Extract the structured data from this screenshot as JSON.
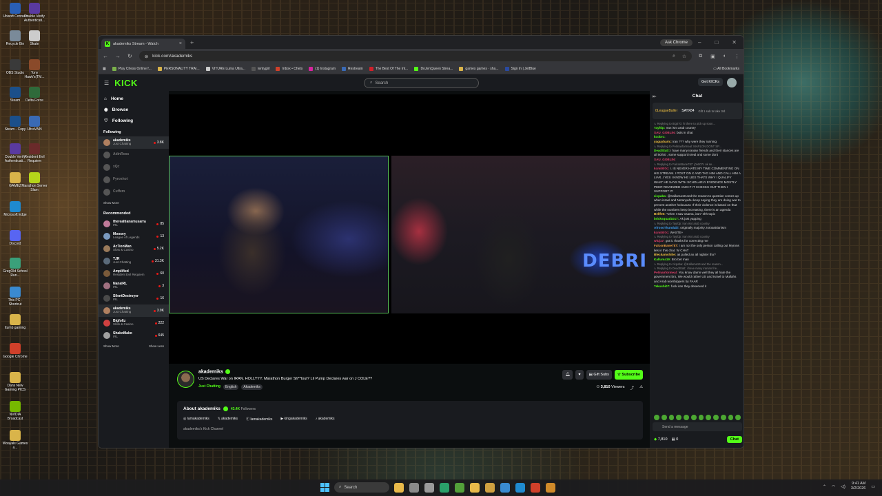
{
  "desktop": {
    "icons": [
      {
        "label": "Ubisoft Connect",
        "color": "#2a5fb5"
      },
      {
        "label": "Double Verify Authenticati...",
        "color": "#5a3aa0"
      },
      {
        "label": "Recycle Bin",
        "color": "#7a8a99"
      },
      {
        "label": "Skate",
        "color": "#cccccc"
      },
      {
        "label": "OBS Studio",
        "color": "#3a3a3a"
      },
      {
        "label": "Tony Hawk's(TM...",
        "color": "#8a4a2a"
      },
      {
        "label": "Steam",
        "color": "#1b4f8a"
      },
      {
        "label": "Delta Force",
        "color": "#2f6a3a"
      },
      {
        "label": "Steam - Copy",
        "color": "#1b4f8a"
      },
      {
        "label": "UltraVNN",
        "color": "#3a6ab5"
      },
      {
        "label": "Double Verify Authenticati...",
        "color": "#5a3aa0"
      },
      {
        "label": "Resident Evil Requiem",
        "color": "#6a2a2a"
      },
      {
        "label": "GAMEZ",
        "color": "#d9b44a"
      },
      {
        "label": "Marathon Server Slam",
        "color": "#b5d41a"
      },
      {
        "label": "Microsoft Edge",
        "color": "#1f8ad0"
      },
      {
        "label": "Discord",
        "color": "#5865f2"
      },
      {
        "label": "GregOld School Run...",
        "color": "#3aa07a"
      },
      {
        "label": "This PC - Shortcut",
        "color": "#3a8ad0"
      },
      {
        "label": "ttumb gaming",
        "color": "#d9b44a"
      },
      {
        "label": "Google Chrome",
        "color": "#d0402a"
      },
      {
        "label": "Dans New Gaming PICS",
        "color": "#d9b44a"
      },
      {
        "label": "NVIDIA Broadcast",
        "color": "#76b900"
      },
      {
        "label": "Woayals Games a...",
        "color": "#d9b44a"
      }
    ]
  },
  "browser": {
    "tab_title": "akademiks Stream - Watch",
    "ask_chrome": "Ask Chrome",
    "url": "kick.com/akademiks",
    "bookmarks": [
      {
        "label": "Play Chess Online f...",
        "color": "#7ab04a"
      },
      {
        "label": "PERSONALITY TRAI...",
        "color": "#d9b44a"
      },
      {
        "label": "VITURE Luma Ultra...",
        "color": "#cccccc"
      },
      {
        "label": "tentygirl",
        "color": "#555555"
      },
      {
        "label": "Inbox • Chets",
        "color": "#d0402a"
      },
      {
        "label": "(1) Instagram",
        "color": "#d6249f"
      },
      {
        "label": "Restream",
        "color": "#3a6ab5"
      },
      {
        "label": "The Best Of The Int...",
        "color": "#d0202a"
      },
      {
        "label": "DoJenQueen Strea...",
        "color": "#53fc18"
      },
      {
        "label": "games games · sha...",
        "color": "#d9b44a"
      },
      {
        "label": "Sign In | JetBlue",
        "color": "#2a4aa0"
      }
    ],
    "all_bookmarks": "All Bookmarks"
  },
  "kick": {
    "logo": "KICK",
    "search_placeholder": "Search",
    "get_kicks": "Get KICKs",
    "nav": [
      {
        "label": "Home",
        "icon": "home-icon",
        "glyph": "⌂"
      },
      {
        "label": "Browse",
        "icon": "browse-icon",
        "glyph": "◉"
      },
      {
        "label": "Following",
        "icon": "heart-icon",
        "glyph": "♡"
      }
    ],
    "following_header": "Following",
    "following": [
      {
        "name": "akademiks",
        "category": "Just Chatting",
        "viewers": "3.8K",
        "online": true,
        "color": "#b08060"
      },
      {
        "name": "AdinRoss",
        "category": "",
        "viewers": "",
        "online": false,
        "color": "#555555"
      },
      {
        "name": "xQc",
        "category": "",
        "viewers": "",
        "online": false,
        "color": "#555555"
      },
      {
        "name": "Fyroshot",
        "category": "",
        "viewers": "",
        "online": false,
        "color": "#555555"
      },
      {
        "name": "Cuffem",
        "category": "",
        "viewers": "",
        "online": false,
        "color": "#555555"
      }
    ],
    "show_more_1": "Show More",
    "recommended_header": "Recommended",
    "recommended": [
      {
        "name": "therealtianamusarra",
        "category": "IRL",
        "viewers": "85",
        "color": "#c07a9a"
      },
      {
        "name": "Moosey",
        "category": "League of Legends",
        "viewers": "13",
        "color": "#7a9ac0"
      },
      {
        "name": "Ac7ionMan",
        "category": "Slots & Casino",
        "viewers": "5.2K",
        "color": "#9a7a5a"
      },
      {
        "name": "TJR",
        "category": "Just Chatting",
        "viewers": "31.3K",
        "color": "#5a6a7a"
      },
      {
        "name": "Amplified",
        "category": "Resident Evil Requiem",
        "viewers": "60",
        "color": "#7a5a3a"
      },
      {
        "name": "NanaIRL",
        "category": "IRL",
        "viewers": "3",
        "color": "#a07080"
      },
      {
        "name": "SilentDestroyer",
        "category": "IRL",
        "viewers": "16",
        "color": "#4a4a4a"
      },
      {
        "name": "akademiks",
        "category": "Just Chatting",
        "viewers": "3.9K",
        "color": "#b08060"
      },
      {
        "name": "Bigfoltz",
        "category": "Slots & Casino",
        "viewers": "222",
        "color": "#d04040"
      },
      {
        "name": "ShakoMako",
        "category": "IRL",
        "viewers": "645",
        "color": "#a0a0a0"
      }
    ],
    "show_more_2": "Show More",
    "show_less": "Show Less",
    "video_overlay_text": "DEBRI",
    "stream": {
      "channel": "akademiks",
      "title": "US Declares War on IRAN. HOLLYYY. Marathon Burger Sh**tout? Lil Pump Declares war on J COLE??",
      "category": "Just Chatting",
      "tags": [
        "English",
        "Akademiks"
      ],
      "gift_subs": "Gift Subs",
      "subscribe": "Subscribe",
      "viewers": "3,810",
      "viewers_label": "Viewers"
    },
    "about": {
      "title": "About akademiks",
      "followers": "43.4K",
      "followers_label": "Followers",
      "socials": [
        {
          "label": "lamakademiks",
          "icon": "instagram-icon",
          "glyph": "◎"
        },
        {
          "label": "akademiks",
          "icon": "x-icon",
          "glyph": "𝕏"
        },
        {
          "label": "lamakademiks",
          "icon": "facebook-icon",
          "glyph": "ⓕ"
        },
        {
          "label": "kingakademiks",
          "icon": "youtube-icon",
          "glyph": "▶"
        },
        {
          "label": "akademiks",
          "icon": "tiktok-icon",
          "glyph": "♪"
        }
      ],
      "description": "akademiks's Kick Channel"
    },
    "chat": {
      "title": "Chat",
      "pinned_user1": "0LeagueBaller",
      "pinned_user2": "SATX84",
      "pinned_text": "Gift 1 sub to take 3rd",
      "messages": [
        {
          "user": "",
          "color": "#888888",
          "text": "Replying to Big070: hi there to pick up soon...",
          "reply": true
        },
        {
          "user": "Tayfdp:",
          "color": "#53fc18",
          "text": "Iran isnt arab country"
        },
        {
          "user": "SAU_GOBLIN:",
          "color": "#e0406a",
          "text": "bots in chat"
        },
        {
          "user": "kcobrc:",
          "color": "#53fc18",
          "text": ""
        },
        {
          "user": "yaguybaric:",
          "color": "#f0c040",
          "text": "iran ??? why were they running"
        },
        {
          "user": "",
          "color": "#888888",
          "text": "Replying to Pelmanformeal: MARLON DONT SP...",
          "reply": true
        },
        {
          "user": "DeadStatt:",
          "color": "#53fc18",
          "text": "i have many iranian friends and their stances are all 50/50 , some support isreal and some dont"
        },
        {
          "user": "SAU_GOBLIN:",
          "color": "#e0406a",
          "text": ""
        },
        {
          "user": "",
          "color": "#888888",
          "text": "Replying to FalconBane787: j0e007c ok se...",
          "reply": true
        },
        {
          "user": "kcmi007c:",
          "color": "#e0406a",
          "text": "I. IS NEVER HATE MY TIME COMMENTING ON HIS STREAM. I POST ON X AND TAG HIM AND CALL HIM A LIAR..I YES I KNOW HE LIES THATS WHY I QUALIFY WHAT HE SAYS WITH SCHOLARLY EVIDENCE MOSTLY PEER REVIEWED AND IF IT CHECKS OUT THEN I SUPPORT IT."
        },
        {
          "user": "zicpaba:",
          "color": "#53fc18",
          "text": "@Kalluma19 and the reason to question comes up when israel and Netanyahu keep saying they are doing war to prevent another holocaust. If their violence is based on that while the numbers keep increasing, there is an agenda"
        },
        {
          "user": "Bellfe5:",
          "color": "#f0c040",
          "text": "\"when I saw osama, iran\" shh topic"
        },
        {
          "user": "bricksquad1017:",
          "color": "#53fc18",
          "text": "Ak just yapping"
        },
        {
          "user": "",
          "color": "#888888",
          "text": "Replying to Tayfdp: Iran isnt arab country",
          "reply": true
        },
        {
          "user": "AfrosoThundabi:",
          "color": "#40a0f0",
          "text": "originally majority zoroastrianism"
        },
        {
          "user": "kcmi007c:",
          "color": "#e0406a",
          "text": "WASTE+"
        },
        {
          "user": "",
          "color": "#888888",
          "text": "Replying to Tayfdp: Iran isnt arab country",
          "reply": true
        },
        {
          "user": "wluj17:",
          "color": "#e0406a",
          "text": "got it. thanks for correcting me"
        },
        {
          "user": "FalconBane787:",
          "color": "#f0a040",
          "text": "i am not the only person calling out Myrons lies in this chat. W CHAT"
        },
        {
          "user": "Bleckamshilie:",
          "color": "#f0c040",
          "text": "ak pulled an all nighter tho?"
        },
        {
          "user": "Kalluma19:",
          "color": "#53fc18",
          "text": "Bro bet man"
        },
        {
          "user": "",
          "color": "#888888",
          "text": "Replying to zicpaba: @Kalluma19 and the reason...",
          "reply": true
        },
        {
          "user": "",
          "color": "#888888",
          "text": "Replying to DeadStatt: i have many iranian frie...",
          "reply": true
        },
        {
          "user": "Pelmanformeal:",
          "color": "#e0406a",
          "text": "You know damn well they all hate the government bro, We would rather US and Israel to Mullahs and Arab worshippers by FAAR"
        },
        {
          "user": "Tekushi07:",
          "color": "#53fc18",
          "text": "fuck iran they deserved it"
        }
      ],
      "input_placeholder": "Send a message",
      "points": "7,810",
      "gifts": "0",
      "chat_button": "Chat"
    }
  },
  "taskbar": {
    "search_label": "Search",
    "apps": [
      {
        "icon": "file-explorer-icon",
        "color": "#e8b94a"
      },
      {
        "icon": "task-view-icon",
        "color": "#8a8a8a"
      },
      {
        "icon": "settings-icon",
        "color": "#9a9a9a"
      },
      {
        "icon": "terminal-icon",
        "color": "#2aa06a"
      },
      {
        "icon": "xbox-icon",
        "color": "#53a03a"
      },
      {
        "icon": "folder-icon",
        "color": "#e8b94a"
      },
      {
        "icon": "store-icon",
        "color": "#d0a040"
      },
      {
        "icon": "check-icon",
        "color": "#3a8ad0"
      },
      {
        "icon": "edge-icon",
        "color": "#1f8ad0"
      },
      {
        "icon": "chrome-icon",
        "color": "#d0402a"
      },
      {
        "icon": "chrome-2-icon",
        "color": "#d08a2a"
      }
    ],
    "time": "9:41 AM",
    "date": "3/2/2026"
  }
}
